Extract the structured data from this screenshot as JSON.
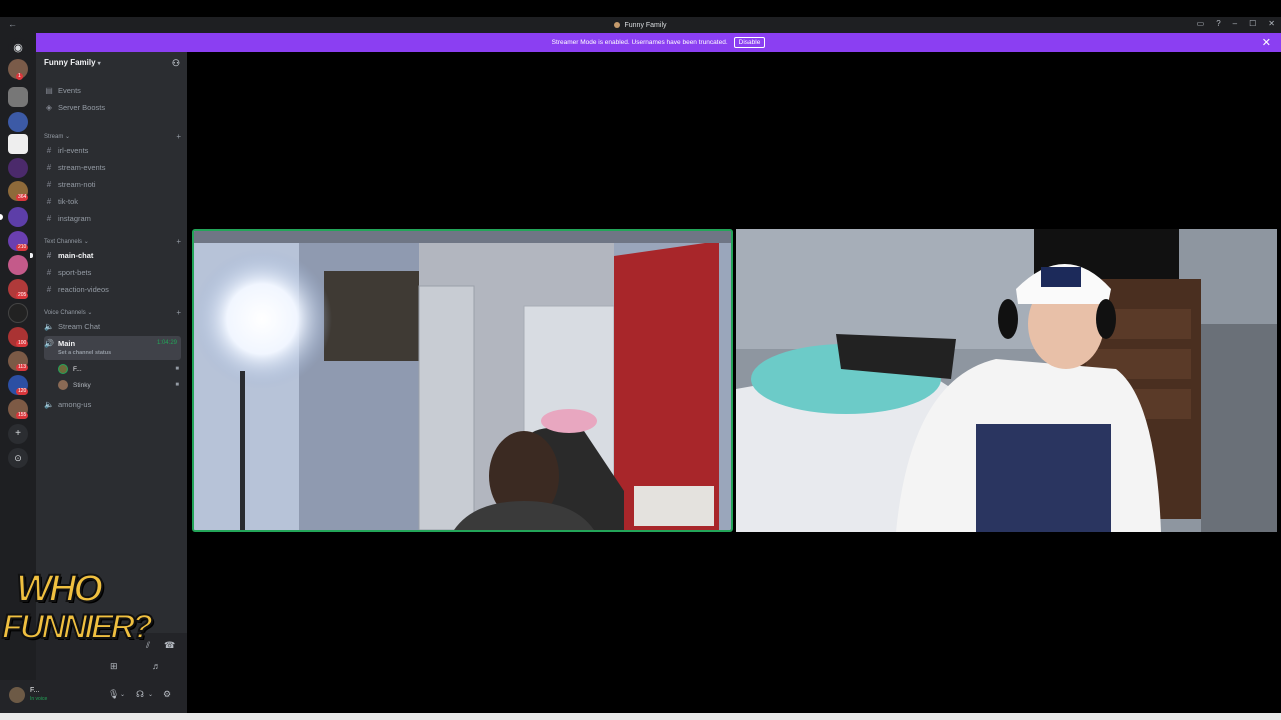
{
  "window": {
    "title": "Funny Family",
    "back_glyph": "←",
    "controls": [
      "▭",
      "?",
      "–",
      "☐",
      "✕"
    ]
  },
  "banner": {
    "text": "Streamer Mode is enabled. Usernames have been truncated.",
    "button": "Disable",
    "close_glyph": "✕"
  },
  "server_rail": {
    "badges": [
      "1",
      "364",
      "210",
      "205",
      "100",
      "113",
      "120",
      "155"
    ]
  },
  "sidebar": {
    "server_name": "Funny Family",
    "top_items": [
      {
        "label": "Events",
        "icon": "calendar-icon"
      },
      {
        "label": "Server Boosts",
        "icon": "boost-icon"
      }
    ],
    "categories": {
      "stream": "Stream",
      "text": "Text Channels",
      "voice": "Voice Channels"
    },
    "stream_channels": [
      "irl-events",
      "stream-events",
      "stream-noti",
      "tik-tok",
      "instagram"
    ],
    "text_channels": [
      "main-chat",
      "sport-bets",
      "reaction-videos"
    ],
    "voice_channels": {
      "stream_chat": "Stream Chat",
      "main": "Main",
      "main_timer": "1:04:29",
      "main_status": "Set a channel status",
      "users": [
        "F...",
        "Stinky"
      ],
      "among_us": "among-us"
    }
  },
  "overlay": {
    "line1": "WHO",
    "line2": "FUNNIER?"
  },
  "user_panel": {
    "name": "F...",
    "status": "In voice"
  }
}
